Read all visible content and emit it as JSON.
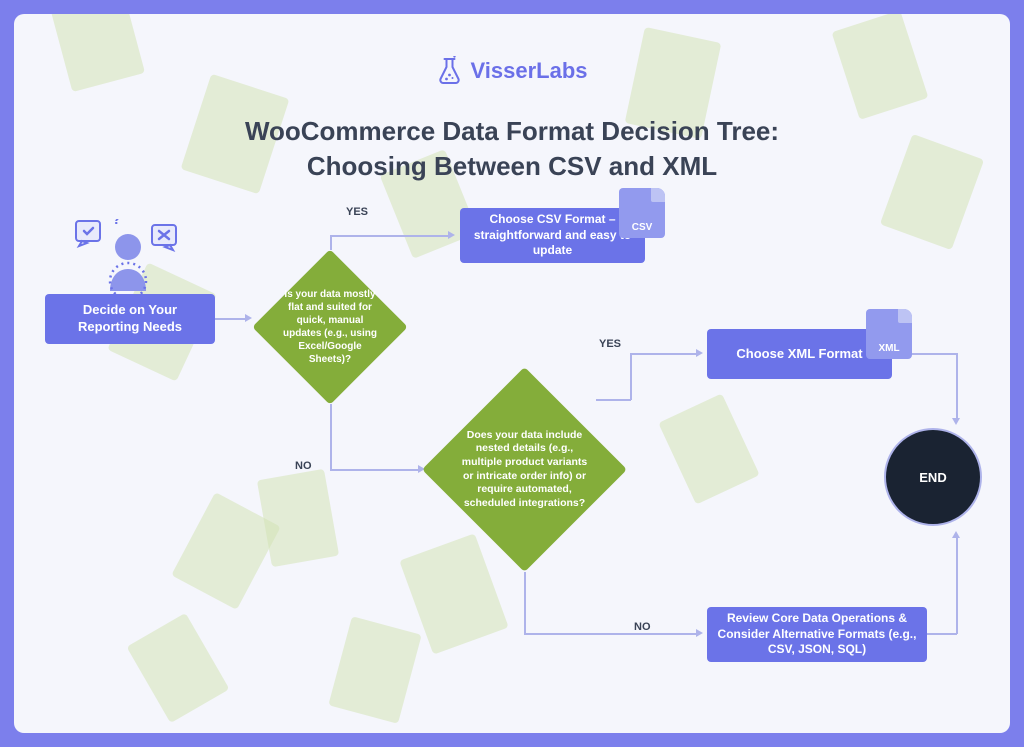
{
  "brand": "VisserLabs",
  "title": "WooCommerce Data Format Decision Tree:\nChoosing Between CSV and XML",
  "nodes": {
    "start": "Decide on Your Reporting Needs",
    "q1": "Is your data mostly flat and suited for quick, manual updates (e.g., using Excel/Google Sheets)?",
    "csv": "Choose CSV Format – straightforward and easy to update",
    "q2": "Does your data include nested details (e.g., multiple product variants or intricate order info) or require automated, scheduled integrations?",
    "xml": "Choose XML Format",
    "alt": "Review Core Data Operations & Consider Alternative Formats (e.g., CSV, JSON, SQL)",
    "end": "END"
  },
  "labels": {
    "yes": "YES",
    "no": "NO"
  },
  "badges": {
    "csv": "CSV",
    "xml": "XML"
  }
}
